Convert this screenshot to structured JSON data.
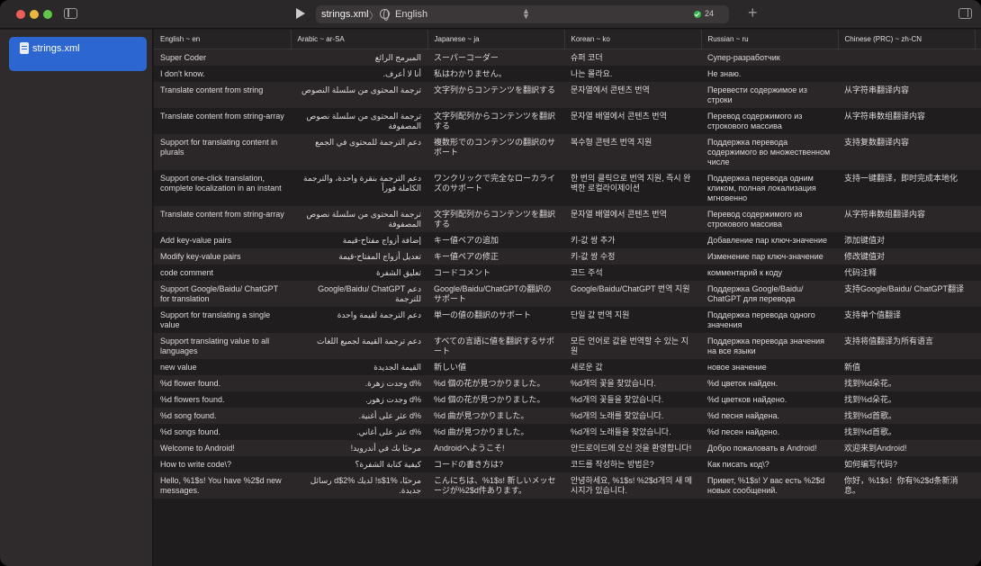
{
  "toolbar": {
    "scheme_file": "strings.xml",
    "scheme_separator": "〉",
    "scheme_language": "English",
    "status_count": "24",
    "add_label": "+"
  },
  "sidebar": {
    "items": [
      {
        "label": "strings.xml",
        "selected": true
      }
    ]
  },
  "table": {
    "headers": [
      "English ~ en",
      "Arabic ~ ar-SA",
      "Japanese ~ ja",
      "Korean ~ ko",
      "Russian ~ ru",
      "Chinese (PRC) ~ zh-CN"
    ],
    "rows": [
      [
        "Super Coder",
        "المبرمج الرائع",
        "スーパーコーダー",
        "슈퍼 코더",
        "Супер-разработчик",
        ""
      ],
      [
        "I don't know.",
        "أنا لا أعرف.",
        "私はわかりません。",
        "나는 몰라요.",
        "Не знаю.",
        ""
      ],
      [
        "Translate content from string",
        "ترجمة المحتوى من سلسلة النصوص",
        "文字列からコンテンツを翻訳する",
        "문자열에서 콘텐츠 번역",
        "Перевести содержимое из строки",
        "从字符串翻译内容"
      ],
      [
        "Translate content from string-array",
        "ترجمة المحتوى من سلسلة نصوص المصفوفة",
        "文字列配列からコンテンツを翻訳する",
        "문자열 배열에서 콘텐츠 번역",
        "Перевод содержимого из строкового массива",
        "从字符串数组翻译内容"
      ],
      [
        "Support for translating content in plurals",
        "دعم الترجمة للمحتوى في الجمع",
        "複数形でのコンテンツの翻訳のサポート",
        "복수형 콘텐츠 번역 지원",
        "Поддержка перевода содержимого во множественном числе",
        "支持复数翻译内容"
      ],
      [
        "Support one-click translation, complete localization in an instant",
        "دعم الترجمة بنقرة واحدة، والترجمة الكاملة فوراً",
        "ワンクリックで完全なローカライズのサポート",
        "한 번의 클릭으로 번역 지원, 즉시 완벽한 로컬라이제이션",
        "Поддержка перевода одним кликом, полная локализация мгновенно",
        "支持一键翻译，即时完成本地化"
      ],
      [
        "Translate content from string-array",
        "ترجمة المحتوى من سلسلة نصوص المصفوفة",
        "文字列配列からコンテンツを翻訳する",
        "문자열 배열에서 콘텐츠 번역",
        "Перевод содержимого из строкового массива",
        "从字符串数组翻译内容"
      ],
      [
        "Add key-value pairs",
        "إضافة أزواج مفتاح-قيمة",
        "キー値ペアの追加",
        "키-값 쌍 추가",
        "Добавление пар ключ-значение",
        "添加键值对"
      ],
      [
        "Modify key-value pairs",
        "تعديل أزواج المفتاح-قيمة",
        "キー値ペアの修正",
        "키-값 쌍 수정",
        "Изменение пар ключ-значение",
        "修改键值对"
      ],
      [
        "code comment",
        "تعليق الشفرة",
        "コードコメント",
        "코드 주석",
        "комментарий к коду",
        "代码注释"
      ],
      [
        "Support Google/Baidu/ ChatGPT for translation",
        "دعم Google/Baidu/ ChatGPT للترجمة",
        "Google/Baidu/ChatGPTの翻訳のサポート",
        "Google/Baidu/ChatGPT 번역 지원",
        "Поддержка Google/Baidu/ ChatGPT для перевода",
        "支持Google/Baidu/ ChatGPT翻译"
      ],
      [
        "Support for translating a single value",
        "دعم الترجمة لقيمة واحدة",
        "単一の値の翻訳のサポート",
        "단일 값 번역 지원",
        "Поддержка перевода одного значения",
        "支持单个值翻译"
      ],
      [
        "Support translating value to all languages",
        "دعم ترجمة القيمة لجميع اللغات",
        "すべての言語に値を翻訳するサポート",
        "모든 언어로 값을 번역할 수 있는 지원",
        "Поддержка перевода значения на все языки",
        "支持将值翻译为所有语言"
      ],
      [
        "new value",
        "القيمة الجديدة",
        "新しい値",
        "새로운 값",
        "новое значение",
        "新值"
      ],
      [
        "%d flower found.",
        "%d وجدت زهرة.",
        "%d 個の花が見つかりました。",
        "%d개의 꽃을 찾았습니다.",
        "%d цветок найден.",
        "找到%d朵花。"
      ],
      [
        "%d flowers found.",
        "%d وجدت زهور.",
        "%d 個の花が見つかりました。",
        "%d개의 꽃들을 찾았습니다.",
        "%d цветков найдено.",
        "找到%d朵花。"
      ],
      [
        "%d song found.",
        "%d عثر على أغنية.",
        "%d 曲が見つかりました。",
        "%d개의 노래를 찾았습니다.",
        "%d песня найдена.",
        "找到%d首歌。"
      ],
      [
        "%d songs found.",
        "%d عثر على أغاني.",
        "%d 曲が見つかりました。",
        "%d개의 노래들을 찾았습니다.",
        "%d песен найдено.",
        "找到%d首歌。"
      ],
      [
        "Welcome to Android!",
        "مرحبًا بك في أندرويد!",
        "Androidへようこそ!",
        "안드로이드에 오신 것을 환영합니다!",
        "Добро пожаловать в Android!",
        "欢迎来到Android!"
      ],
      [
        "How to write code\\?",
        "كيفية كتابة الشفرة؟",
        "コードの書き方は?",
        "코드를 작성하는 방법은?",
        "Как писать код\\?",
        "如何编写代码?"
      ],
      [
        "Hello, %1$s! You have %2$d new messages.",
        "مرحبًا، %1$s! لديك %2$d رسائل جديدة.",
        "こんにちは、%1$s! 新しいメッセージが%2$d件あります。",
        "안녕하세요, %1$s! %2$d개의 새 메시지가 있습니다.",
        "Привет, %1$s! У вас есть %2$d новых сообщений.",
        "你好，%1$s！你有%2$d条新消息。"
      ]
    ]
  }
}
